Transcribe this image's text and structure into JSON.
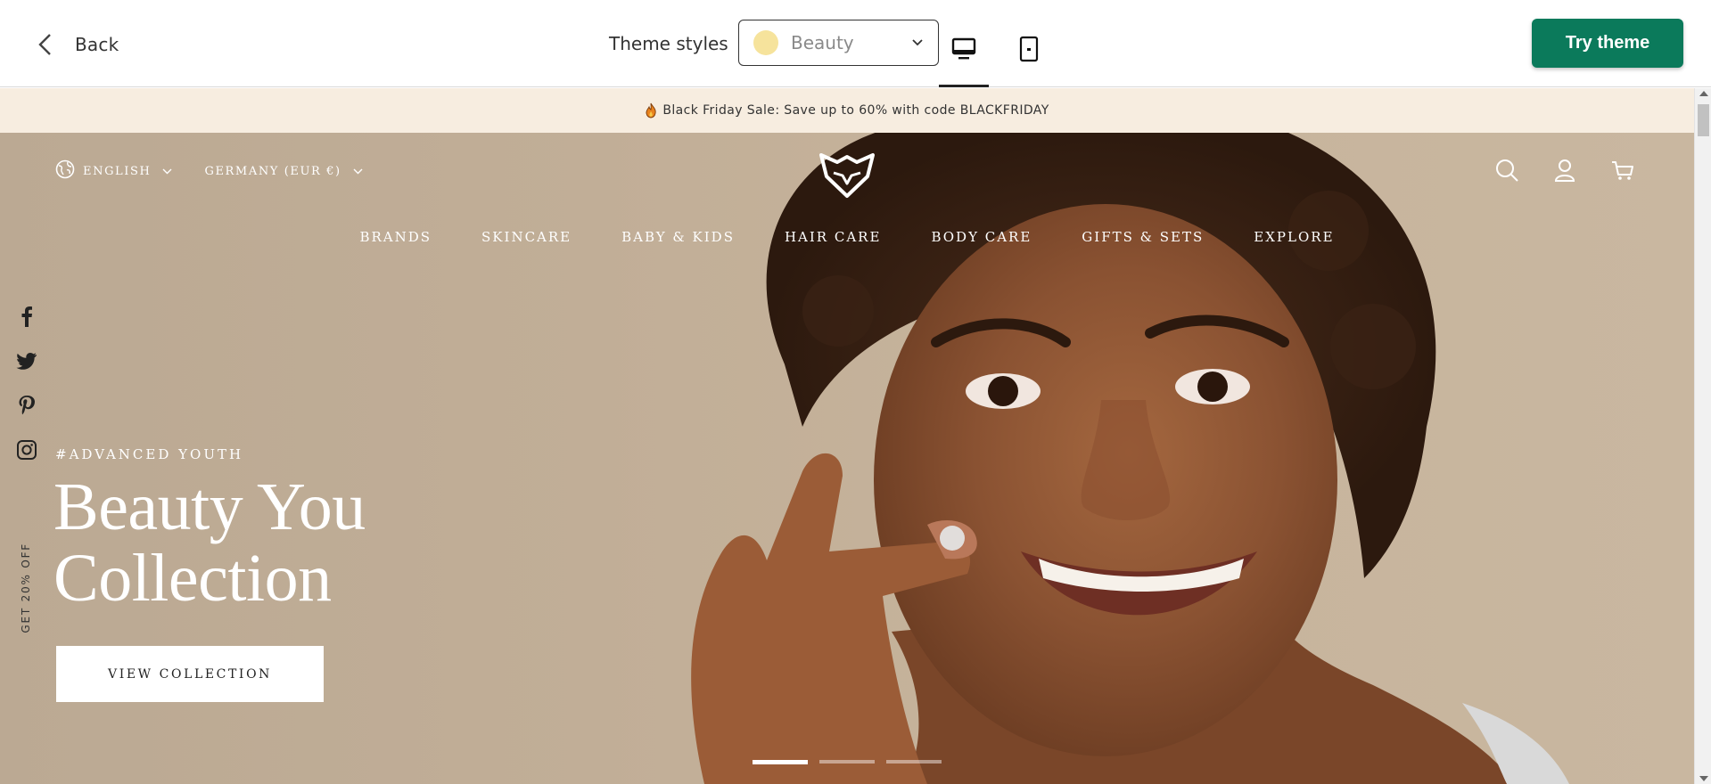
{
  "toolbar": {
    "back_label": "Back",
    "theme_styles_label": "Theme styles",
    "theme_style_value": "Beauty",
    "swatch_color": "#f6e39c",
    "desktop_icon": "desktop-icon",
    "mobile_icon": "mobile-icon",
    "try_theme_label": "Try theme",
    "try_theme_color": "#0b7a5b"
  },
  "announcement": {
    "text": "Black Friday Sale: Save up to 60% with code BLACKFRIDAY",
    "icon": "fire-icon"
  },
  "header": {
    "language": "ENGLISH",
    "currency": "GERMANY (EUR €)",
    "icons": [
      "search-icon",
      "account-icon",
      "cart-icon"
    ]
  },
  "nav": {
    "items": [
      "BRANDS",
      "SKINCARE",
      "BABY & KIDS",
      "HAIR CARE",
      "BODY CARE",
      "GIFTS & SETS",
      "EXPLORE"
    ]
  },
  "social": [
    "facebook-icon",
    "twitter-icon",
    "pinterest-icon",
    "instagram-icon"
  ],
  "side_promo": "GET 20% OFF",
  "hero": {
    "eyebrow": "#ADVANCED YOUTH",
    "title_line1": "Beauty You",
    "title_line2": "Collection",
    "cta_label": "VIEW COLLECTION",
    "slides_total": 3,
    "active_slide": 1
  }
}
